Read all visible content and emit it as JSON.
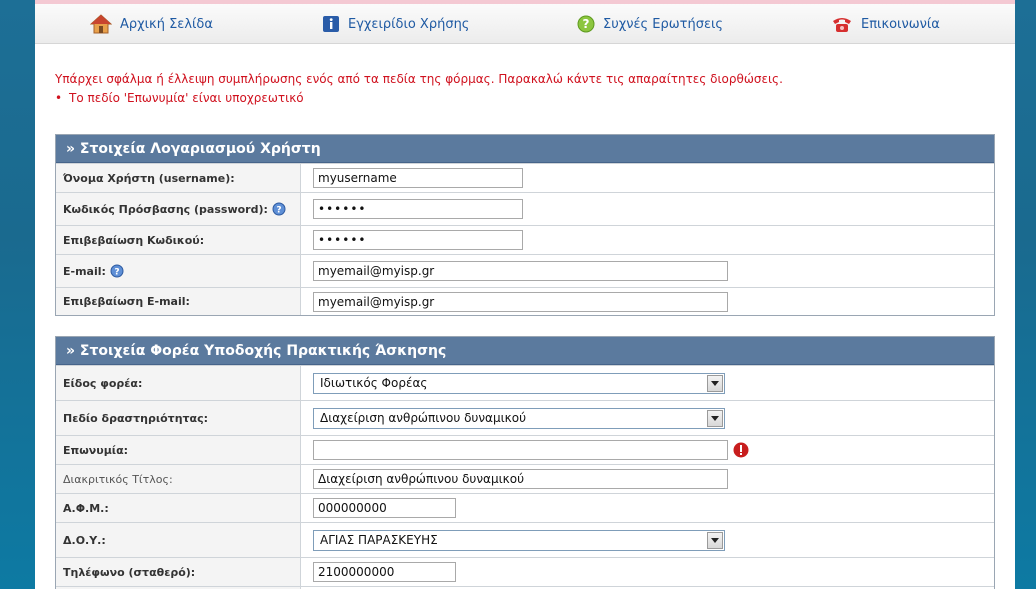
{
  "nav": {
    "home": "Αρχική Σελίδα",
    "manual": "Εγχειρίδιο Χρήσης",
    "faq": "Συχνές Ερωτήσεις",
    "contact": "Επικοινωνία"
  },
  "errors": {
    "summary": "Υπάρχει σφάλμα ή έλλειψη συμπλήρωσης ενός από τα πεδία της φόρμας. Παρακαλώ κάντε τις απαραίτητες διορθώσεις.",
    "items": [
      "Το πεδίο 'Επωνυμία' είναι υποχρεωτικό"
    ]
  },
  "account": {
    "title": "» Στοιχεία Λογαριασμού Χρήστη",
    "username_label": "Όνομα Χρήστη (username):",
    "username_value": "myusername",
    "password_label": "Κωδικός Πρόσβασης (password):",
    "password_value": "••••••",
    "password_confirm_label": "Επιβεβαίωση Κωδικού:",
    "password_confirm_value": "••••••",
    "email_label": "E-mail:",
    "email_value": "myemail@myisp.gr",
    "email_confirm_label": "Επιβεβαίωση E-mail:",
    "email_confirm_value": "myemail@myisp.gr"
  },
  "org": {
    "title": "» Στοιχεία Φορέα Υποδοχής Πρακτικής Άσκησης",
    "type_label": "Είδος φορέα:",
    "type_value": "Ιδιωτικός Φορέας",
    "field_label": "Πεδίο δραστηριότητας:",
    "field_value": "Διαχείριση ανθρώπινου δυναμικού",
    "name_label": "Επωνυμία:",
    "name_value": "",
    "distinct_title_label": "Διακριτικός Τίτλος:",
    "distinct_title_value": "Διαχείριση ανθρώπινου δυναμικού",
    "afm_label": "Α.Φ.Μ.:",
    "afm_value": "000000000",
    "doy_label": "Δ.Ο.Υ.:",
    "doy_value": "ΑΓΙΑΣ ΠΑΡΑΣΚΕΥΗΣ",
    "phone_label": "Τηλέφωνο (σταθερό):",
    "phone_value": "2100000000"
  },
  "colors": {
    "section_header": "#5b7a9e",
    "error_text": "#d0121f",
    "nav_link": "#1f5aa3"
  }
}
